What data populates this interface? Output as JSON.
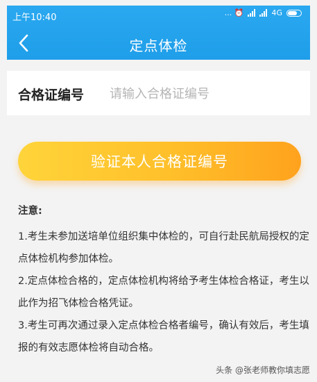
{
  "status_bar": {
    "time": "上午10:40",
    "icons_text": "... ⏰",
    "network": "4G"
  },
  "header": {
    "title": "定点体检",
    "back_icon": "chevron-left-icon"
  },
  "form": {
    "label": "合格证编号",
    "placeholder": "请输入合格证编号",
    "value": ""
  },
  "verify_button": {
    "label": "验证本人合格证编号"
  },
  "notes": {
    "title": "注意:",
    "items": [
      "1.考生未参加送培单位组织集中体检的，可自行赴民航局授权的定点体检机构参加体检。",
      "2.定点体检合格的，定点体检机构将给予考生体检合格证，考生以此作为招飞体检合格凭证。",
      "3.考生可再次通过录入定点体检合格者编号，确认有效后，考生填报的有效志愿体检将自动合格。"
    ]
  },
  "watermark": "头条 @张老师教你填志愿",
  "colors": {
    "header": "#1f9ee9",
    "button_start": "#ffd43a",
    "button_end": "#ffa21d",
    "background": "#f3f3f3"
  }
}
